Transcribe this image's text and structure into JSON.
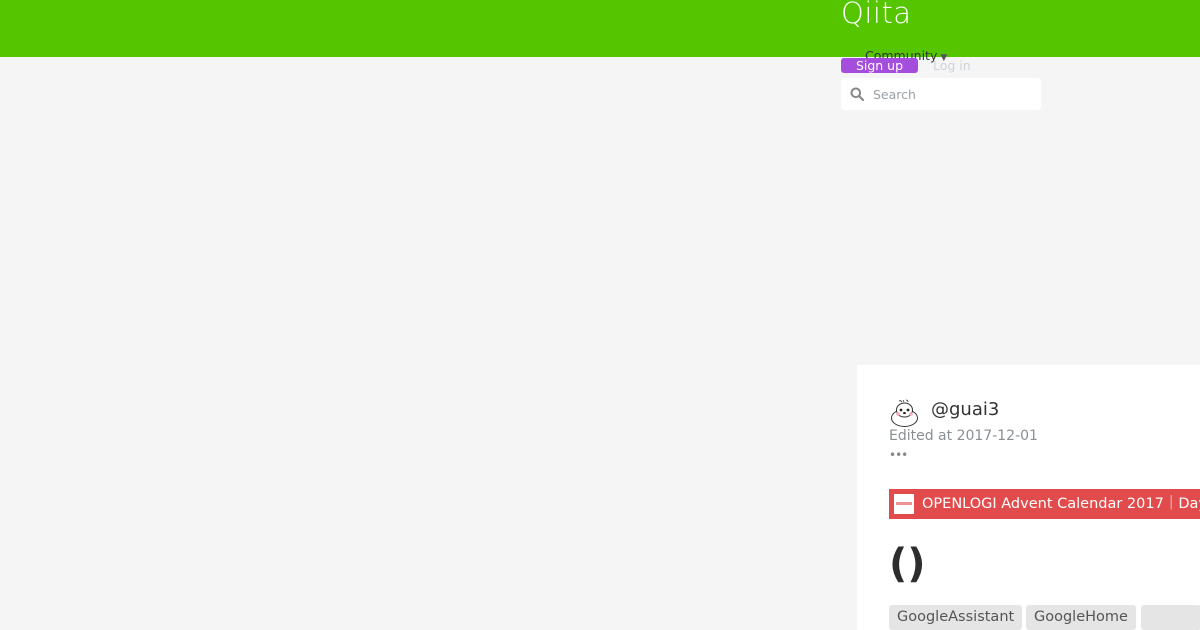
{
  "header": {
    "logo": "Qiita",
    "community_label": "Community",
    "signup_label": "Sign up",
    "login_label": "Log in",
    "search": {
      "placeholder": "Search",
      "value": ""
    }
  },
  "article": {
    "username": "@guai3",
    "edited_at": "Edited at 2017-12-01",
    "more_label": "•••",
    "advent_calendar": "OPENLOGI Advent Calendar 2017｜Day",
    "title": "()",
    "tags": [
      "GoogleAssistant",
      "GoogleHome",
      ""
    ]
  },
  "colors": {
    "header_bg": "#55c500",
    "signup_bg": "#a54ddc",
    "advent_bg": "#e24b4b",
    "page_bg": "#f5f5f5"
  },
  "icons": [
    "search-icon",
    "caret-down-icon",
    "avatar",
    "openlogi-logo"
  ]
}
